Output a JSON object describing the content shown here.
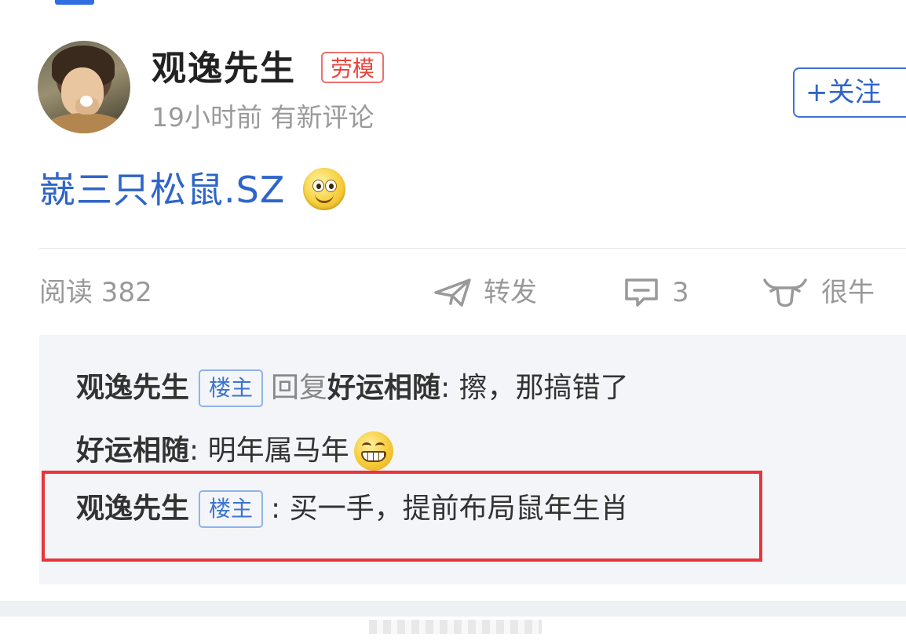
{
  "post": {
    "author": "观逸先生",
    "author_badge": "劳模",
    "time": "19小时前",
    "status": "有新评论",
    "follow_label": "+关注",
    "content": "㠇三只松鼠.SZ",
    "content_emoji": "smile-emoji"
  },
  "stats": {
    "read_label": "阅读 382",
    "forward_label": "转发",
    "comment_count": "3",
    "like_label": "很牛"
  },
  "replies": [
    {
      "name": "观逸先生",
      "tag": "楼主",
      "reply_word": "回复",
      "target": "好运相随",
      "text": ": 擦，那搞错了"
    },
    {
      "name": "好运相随",
      "text": ": 明年属马年",
      "emoji": "grin-emoji"
    },
    {
      "name": "观逸先生",
      "tag": "楼主",
      "text": ": 买一手，提前布局鼠年生肖"
    }
  ],
  "colors": {
    "link_blue": "#2f65c9",
    "badge_red": "#e8453c",
    "highlight_red": "#e8343a",
    "tag_blue": "#3a74d4"
  }
}
